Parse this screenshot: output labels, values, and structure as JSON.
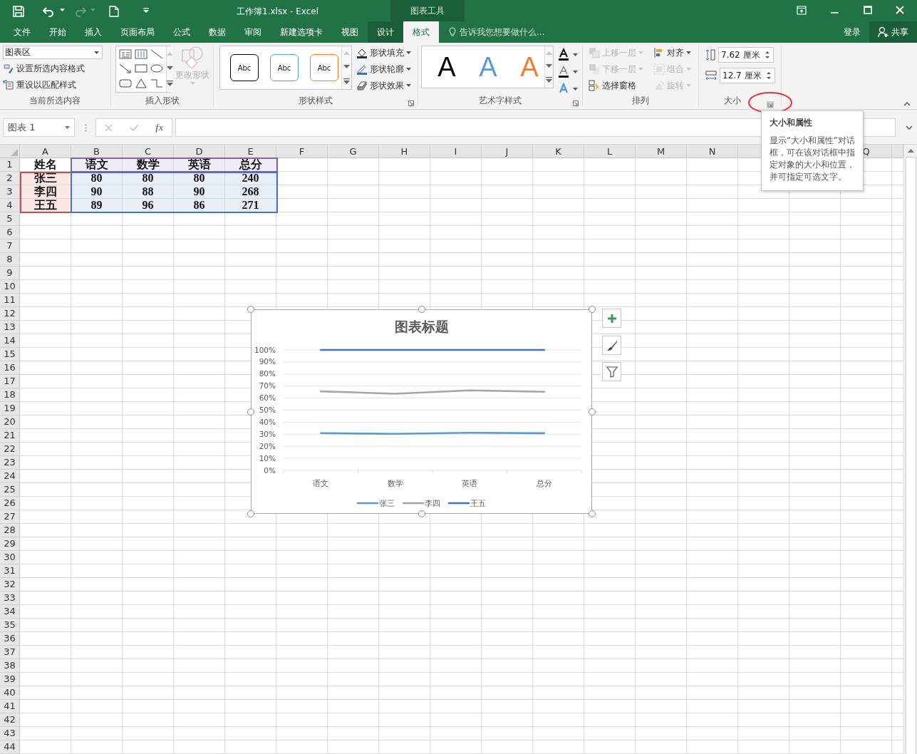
{
  "title_bar": {
    "title": "工作簿1.xlsx - Excel",
    "context_group": "图表工具"
  },
  "ribbon_tabs": [
    {
      "label": "文件",
      "selected": false,
      "contextual": false
    },
    {
      "label": "开始",
      "selected": false,
      "contextual": false
    },
    {
      "label": "插入",
      "selected": false,
      "contextual": false
    },
    {
      "label": "页面布局",
      "selected": false,
      "contextual": false
    },
    {
      "label": "公式",
      "selected": false,
      "contextual": false
    },
    {
      "label": "数据",
      "selected": false,
      "contextual": false
    },
    {
      "label": "审阅",
      "selected": false,
      "contextual": false
    },
    {
      "label": "新建选项卡",
      "selected": false,
      "contextual": false
    },
    {
      "label": "视图",
      "selected": false,
      "contextual": false
    },
    {
      "label": "设计",
      "selected": false,
      "contextual": true
    },
    {
      "label": "格式",
      "selected": true,
      "contextual": true
    }
  ],
  "tell_me": {
    "placeholder": "告诉我您想要做什么..."
  },
  "account": {
    "sign_in": "登录",
    "share": "共享"
  },
  "ribbon": {
    "current_selection": {
      "label": "当前所选内容",
      "dropdown": "图表区",
      "buttons": [
        {
          "label": "设置所选内容格式"
        },
        {
          "label": "重设以匹配样式"
        }
      ]
    },
    "insert_shapes": {
      "label": "插入形状",
      "change_shape": {
        "label": "更改形状",
        "disabled": true
      }
    },
    "shape_styles": {
      "label": "形状样式",
      "presets": [
        {
          "text": "Abc",
          "color": "#000000"
        },
        {
          "text": "Abc",
          "color": "#5b9bd5"
        },
        {
          "text": "Abc",
          "color": "#ed7d31"
        }
      ],
      "commands": [
        {
          "label": "形状填充"
        },
        {
          "label": "形状轮廓"
        },
        {
          "label": "形状效果"
        }
      ]
    },
    "wordart_styles": {
      "label": "艺术字样式",
      "presets": [
        {
          "text": "A",
          "color": "#000000"
        },
        {
          "text": "A",
          "color": "#5b9bd5"
        },
        {
          "text": "A",
          "color": "#ed7d31"
        }
      ]
    },
    "arrange": {
      "label": "排列",
      "commands": [
        {
          "label": "上移一层",
          "disabled": true
        },
        {
          "label": "下移一层",
          "disabled": true
        },
        {
          "label": "选择窗格",
          "disabled": false
        },
        {
          "label": "对齐",
          "disabled": false
        },
        {
          "label": "组合",
          "disabled": true
        },
        {
          "label": "旋转",
          "disabled": true
        }
      ]
    },
    "size": {
      "label": "大小",
      "height": "7.62 厘米",
      "width": "12.7 厘米"
    }
  },
  "tooltip": {
    "title": "大小和属性",
    "text": "显示“大小和属性”对话框，可在该对话框中指定对象的大小和位置，并可指定可选文字。"
  },
  "formula_bar": {
    "name_box": "图表 1",
    "function_label": "fx"
  },
  "sheet": {
    "columns": [
      {
        "label": "A"
      },
      {
        "label": "B"
      },
      {
        "label": "C"
      },
      {
        "label": "D"
      },
      {
        "label": "E"
      },
      {
        "label": "F"
      },
      {
        "label": "G"
      },
      {
        "label": "H"
      },
      {
        "label": "I"
      },
      {
        "label": "J"
      },
      {
        "label": "K"
      },
      {
        "label": "L"
      },
      {
        "label": "M"
      },
      {
        "label": "N"
      },
      {},
      {},
      {
        "label": "Q"
      }
    ],
    "rows": [
      "1",
      "2",
      "3",
      "4",
      "5",
      "6",
      "7",
      "8",
      "9",
      "10",
      "11",
      "12",
      "13",
      "14",
      "15",
      "16",
      "17",
      "18",
      "19",
      "20",
      "21",
      "22",
      "23",
      "24",
      "25",
      "26",
      "27",
      "28",
      "29",
      "30",
      "31",
      "32",
      "33",
      "34",
      "35",
      "36",
      "37",
      "38",
      "39",
      "40",
      "41",
      "42",
      "43",
      "44"
    ],
    "cells": [
      [
        "姓名",
        "语文",
        "数学",
        "英语",
        "总分"
      ],
      [
        "张三",
        "80",
        "80",
        "80",
        "240"
      ],
      [
        "李四",
        "90",
        "88",
        "90",
        "268"
      ],
      [
        "王五",
        "89",
        "96",
        "86",
        "271"
      ]
    ]
  },
  "chart": {
    "chart_data": {
      "type": "line",
      "title": "图表标题",
      "categories": [
        "语文",
        "数学",
        "英语",
        "总分"
      ],
      "series": [
        {
          "name": "张三",
          "color": "#5b9bd5",
          "values": [
            0.309,
            0.303,
            0.312,
            0.308
          ]
        },
        {
          "name": "李四",
          "color": "#a5a5a5",
          "values": [
            0.656,
            0.636,
            0.664,
            0.652
          ]
        },
        {
          "name": "王五",
          "color": "#4472c4",
          "values": [
            1,
            1,
            1,
            1
          ]
        }
      ],
      "grid": true,
      "legend": "bottom",
      "ylim": [
        0,
        1
      ],
      "yticks": [
        {
          "value": 0,
          "label": "0%"
        },
        {
          "value": 0.1,
          "label": "10%"
        },
        {
          "value": 0.2,
          "label": "20%"
        },
        {
          "value": 0.3,
          "label": "30%"
        },
        {
          "value": 0.4,
          "label": "40%"
        },
        {
          "value": 0.5,
          "label": "50%"
        },
        {
          "value": 0.6,
          "label": "60%"
        },
        {
          "value": 0.7,
          "label": "70%"
        },
        {
          "value": 0.8,
          "label": "80%"
        },
        {
          "value": 0.9,
          "label": "90%"
        },
        {
          "value": 1,
          "label": "100%"
        }
      ]
    }
  }
}
